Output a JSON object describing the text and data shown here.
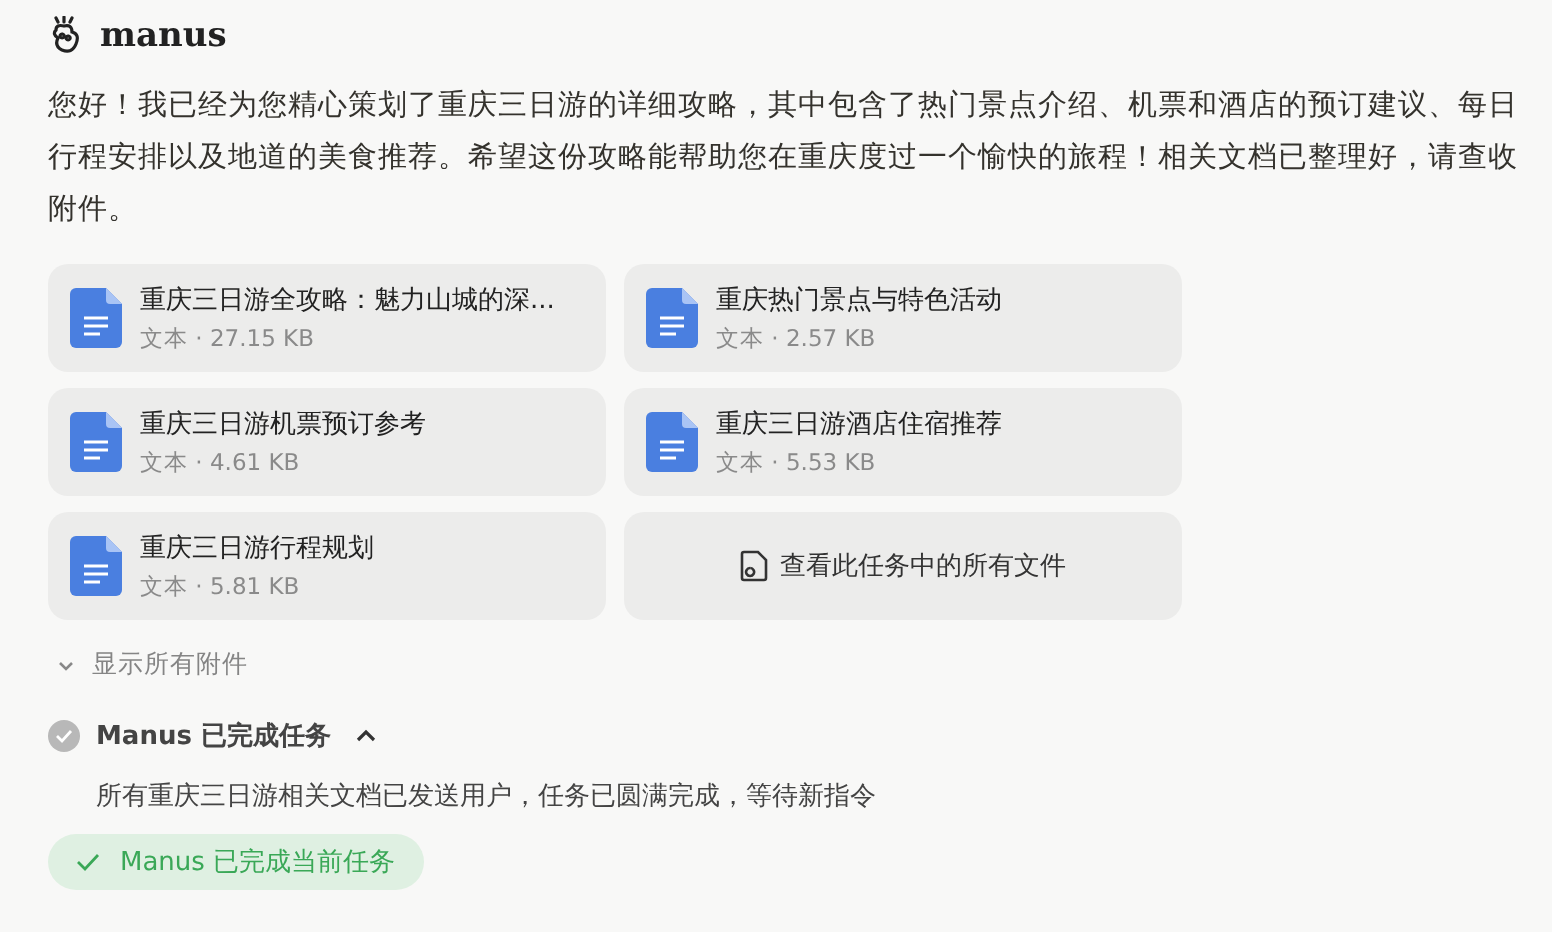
{
  "brand": {
    "name": "manus"
  },
  "message": "您好！我已经为您精心策划了重庆三日游的详细攻略，其中包含了热门景点介绍、机票和酒店的预订建议、每日行程安排以及地道的美食推荐。希望这份攻略能帮助您在重庆度过一个愉快的旅程！相关文档已整理好，请查收附件。",
  "attachments": [
    {
      "kind": "file",
      "name": "重庆三日游全攻略：魅力山城的深...",
      "meta": "文本 · 27.15 KB"
    },
    {
      "kind": "file",
      "name": "重庆热门景点与特色活动",
      "meta": "文本 · 2.57 KB"
    },
    {
      "kind": "file",
      "name": "重庆三日游机票预订参考",
      "meta": "文本 · 4.61 KB"
    },
    {
      "kind": "file",
      "name": "重庆三日游酒店住宿推荐",
      "meta": "文本 · 5.53 KB"
    },
    {
      "kind": "file",
      "name": "重庆三日游行程规划",
      "meta": "文本 · 5.81 KB"
    },
    {
      "kind": "view_all",
      "name": "查看此任务中的所有文件"
    }
  ],
  "show_all": {
    "label": "显示所有附件",
    "expanded": false
  },
  "task": {
    "title": "Manus 已完成任务",
    "expanded": true,
    "detail": "所有重庆三日游相关文档已发送用户，任务已圆满完成，等待新指令"
  },
  "status_badge": "Manus 已完成当前任务"
}
